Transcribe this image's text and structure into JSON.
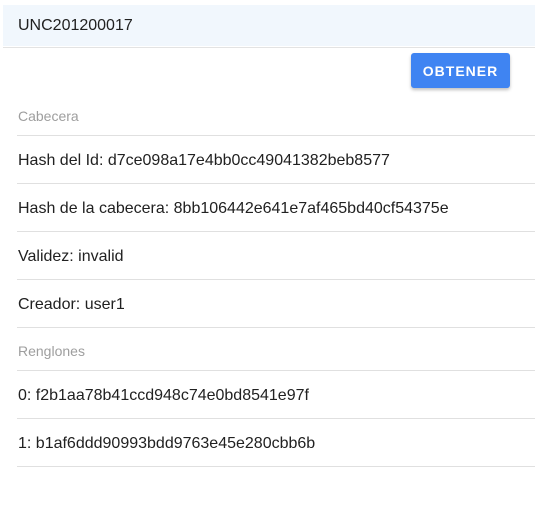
{
  "search": {
    "value": "UNC201200017"
  },
  "actions": {
    "obtener_label": "OBTENER"
  },
  "cabecera": {
    "title": "Cabecera",
    "items": [
      {
        "label": "Hash del Id: d7ce098a17e4bb0cc49041382beb8577"
      },
      {
        "label": "Hash de la cabecera: 8bb106442e641e7af465bd40cf54375e"
      },
      {
        "label": "Validez: invalid"
      },
      {
        "label": "Creador: user1"
      }
    ]
  },
  "renglones": {
    "title": "Renglones",
    "items": [
      {
        "label": "0: f2b1aa78b41ccd948c74e0bd8541e97f"
      },
      {
        "label": "1: b1af6ddd90993bdd9763e45e280cbb6b"
      }
    ]
  },
  "colors": {
    "primary": "#3f84f2",
    "input_background": "#f1f7fd",
    "subheader_text": "#9e9e9e",
    "divider": "#e0e0e0"
  }
}
